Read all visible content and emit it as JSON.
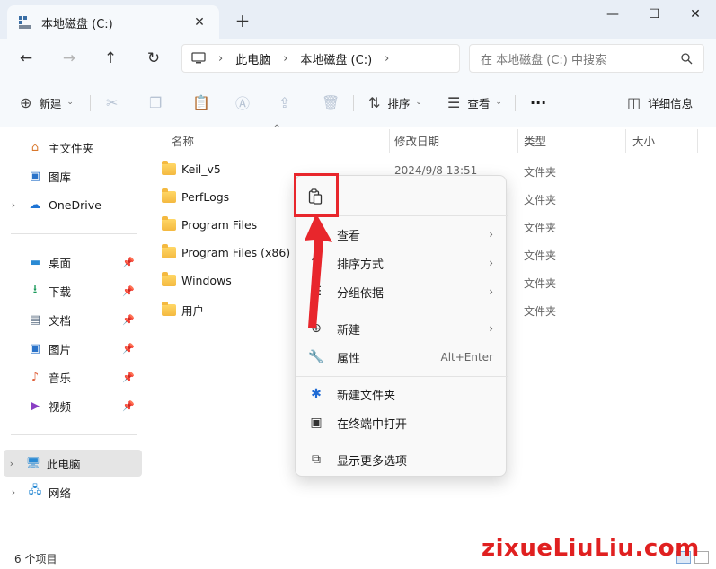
{
  "window": {
    "tab_title": "本地磁盘 (C:)",
    "tab_close": "✕",
    "new_tab": "+",
    "minimize": "—",
    "maximize": "☐",
    "close": "✕"
  },
  "nav": {
    "back": "←",
    "forward": "→",
    "up": "↑",
    "refresh": "↻"
  },
  "address": {
    "crumbs": [
      "此电脑",
      "本地磁盘 (C:)"
    ],
    "search_placeholder": "在 本地磁盘 (C:) 中搜索"
  },
  "toolbar": {
    "new_label": "新建",
    "sort_label": "排序",
    "view_label": "查看",
    "more_label": "···",
    "details_label": "详细信息"
  },
  "sidebar": {
    "items": [
      {
        "label": "主文件夹",
        "icon": "home-icon"
      },
      {
        "label": "图库",
        "icon": "gallery-icon"
      },
      {
        "label": "OneDrive",
        "icon": "cloud-icon"
      },
      {
        "label": "桌面",
        "icon": "desktop-icon"
      },
      {
        "label": "下载",
        "icon": "download-icon"
      },
      {
        "label": "文档",
        "icon": "document-icon"
      },
      {
        "label": "图片",
        "icon": "pictures-icon"
      },
      {
        "label": "音乐",
        "icon": "music-icon"
      },
      {
        "label": "视频",
        "icon": "video-icon"
      },
      {
        "label": "此电脑",
        "icon": "computer-icon"
      },
      {
        "label": "网络",
        "icon": "network-icon"
      }
    ]
  },
  "columns": {
    "name": "名称",
    "date": "修改日期",
    "type": "类型",
    "size": "大小"
  },
  "files": [
    {
      "name": "Keil_v5",
      "date": "2024/9/8 13:51",
      "type": "文件夹"
    },
    {
      "name": "PerfLogs",
      "date": "",
      "type": "文件夹"
    },
    {
      "name": "Program Files",
      "date": "",
      "type": "文件夹"
    },
    {
      "name": "Program Files (x86)",
      "date": "",
      "type": "文件夹"
    },
    {
      "name": "Windows",
      "date": "",
      "type": "文件夹"
    },
    {
      "name": "用户",
      "date": "",
      "type": "文件夹"
    }
  ],
  "context_menu": {
    "view": "查看",
    "sort": "排序方式",
    "group": "分组依据",
    "new": "新建",
    "properties": "属性",
    "properties_shortcut": "Alt+Enter",
    "new_folder": "新建文件夹",
    "open_terminal": "在终端中打开",
    "more_options": "显示更多选项"
  },
  "status": {
    "item_count": "6 个项目"
  },
  "watermark": "zixueLiuLiu.com",
  "colors": {
    "highlight": "#e8262c",
    "accent": "#0067c0",
    "folder": "#f4b940"
  }
}
